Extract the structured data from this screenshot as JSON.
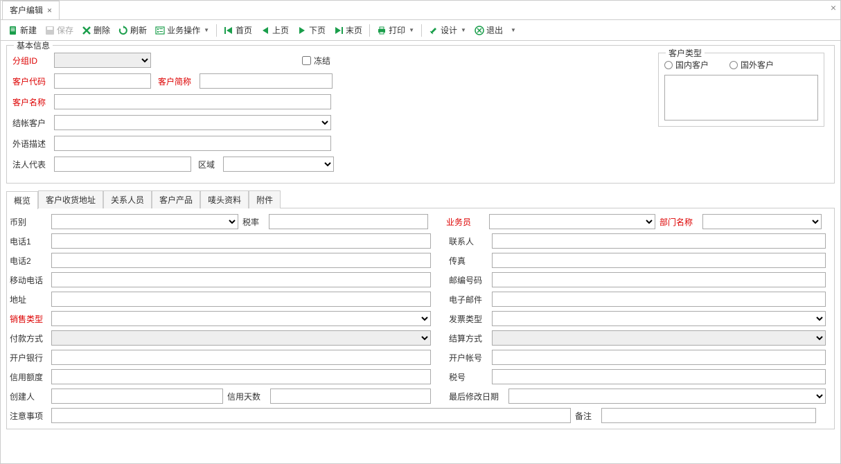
{
  "tab": {
    "title": "客户编辑"
  },
  "toolbar": {
    "new": "新建",
    "save": "保存",
    "delete": "删除",
    "refresh": "刷新",
    "bizop": "业务操作",
    "first": "首页",
    "prev": "上页",
    "next": "下页",
    "last": "末页",
    "print": "打印",
    "design": "设计",
    "exit": "退出"
  },
  "basic": {
    "legend": "基本信息",
    "groupId": "分组ID",
    "frozen": "冻结",
    "custCode": "客户代码",
    "custShort": "客户简称",
    "custName": "客户名称",
    "billCust": "结帐客户",
    "foreignDesc": "外语描述",
    "legalRep": "法人代表",
    "region": "区域",
    "custTypeLegend": "客户类型",
    "custTypeDomestic": "国内客户",
    "custTypeForeign": "国外客户"
  },
  "subtabs": {
    "overview": "概览",
    "shipAddr": "客户收货地址",
    "contacts": "关系人员",
    "products": "客户产品",
    "markInfo": "唛头资料",
    "attach": "附件"
  },
  "ov": {
    "currency": "币别",
    "taxRate": "税率",
    "salesman": "业务员",
    "deptName": "部门名称",
    "phone1": "电话1",
    "contact": "联系人",
    "phone2": "电话2",
    "fax": "传真",
    "mobile": "移动电话",
    "postcode": "邮编号码",
    "address": "地址",
    "email": "电子邮件",
    "salesType": "销售类型",
    "invoiceType": "发票类型",
    "payMethod": "付款方式",
    "settleMethod": "结算方式",
    "bank": "开户银行",
    "account": "开户帐号",
    "creditLimit": "信用额度",
    "taxNo": "税号",
    "creator": "创建人",
    "creditDays": "信用天数",
    "lastModDate": "最后修改日期",
    "notes": "注意事项",
    "remark": "备注"
  }
}
